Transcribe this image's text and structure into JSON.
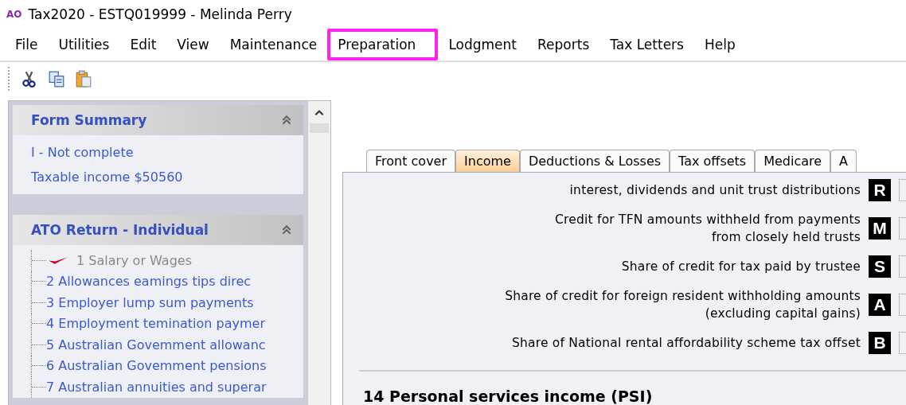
{
  "window": {
    "title": "Tax2020 - ESTQ019999 - Melinda Perry",
    "logo": "AO"
  },
  "menu": [
    {
      "label": "File",
      "highlighted": false
    },
    {
      "label": "Utilities",
      "highlighted": false
    },
    {
      "label": "Edit",
      "highlighted": false
    },
    {
      "label": "View",
      "highlighted": false
    },
    {
      "label": "Maintenance",
      "highlighted": false
    },
    {
      "label": "Preparation",
      "highlighted": true
    },
    {
      "label": "Lodgment",
      "highlighted": false
    },
    {
      "label": "Reports",
      "highlighted": false
    },
    {
      "label": "Tax Letters",
      "highlighted": false
    },
    {
      "label": "Help",
      "highlighted": false
    }
  ],
  "toolbar": [
    {
      "kind": "cut"
    },
    {
      "kind": "copy"
    },
    {
      "kind": "paste"
    }
  ],
  "sidebar": {
    "form_summary": {
      "title": "Form Summary",
      "items": [
        "I - Not complete",
        "Taxable income $50560"
      ]
    },
    "return": {
      "title": "ATO Return - Individual",
      "items": [
        {
          "label": "1 Salary or Wages",
          "checked": true
        },
        {
          "label": "2 Allowances  eamings  tips  direc",
          "checked": false
        },
        {
          "label": "3 Employer lump sum payments",
          "checked": false
        },
        {
          "label": "4 Employment temination paymer",
          "checked": false
        },
        {
          "label": "5 Australian Govemment allowanc",
          "checked": false
        },
        {
          "label": "6 Australian Govemment pensions",
          "checked": false
        },
        {
          "label": "7 Australian annuities and superar",
          "checked": false
        }
      ]
    }
  },
  "tabs": [
    {
      "label": "Front cover",
      "selected": false
    },
    {
      "label": "Income",
      "selected": true
    },
    {
      "label": "Deductions & Losses",
      "selected": false
    },
    {
      "label": "Tax offsets",
      "selected": false
    },
    {
      "label": "Medicare",
      "selected": false
    },
    {
      "label": "A",
      "selected": false
    }
  ],
  "form_rows": [
    {
      "lines": [
        "interest, dividends and unit trust distributions"
      ],
      "code": "R",
      "value": ""
    },
    {
      "lines": [
        "Credit for TFN amounts withheld from payments",
        "from closely held trusts"
      ],
      "code": "M",
      "value": ""
    },
    {
      "lines": [
        "Share of credit for tax paid by trustee"
      ],
      "code": "S",
      "value": ""
    },
    {
      "lines": [
        "Share of credit for foreign resident withholding amounts",
        "(excluding capital gains)"
      ],
      "code": "A",
      "value": ""
    },
    {
      "lines": [
        "Share of National rental affordability scheme tax offset"
      ],
      "code": "B",
      "value": ""
    }
  ],
  "section_heading": "14 Personal services income (PSI)"
}
